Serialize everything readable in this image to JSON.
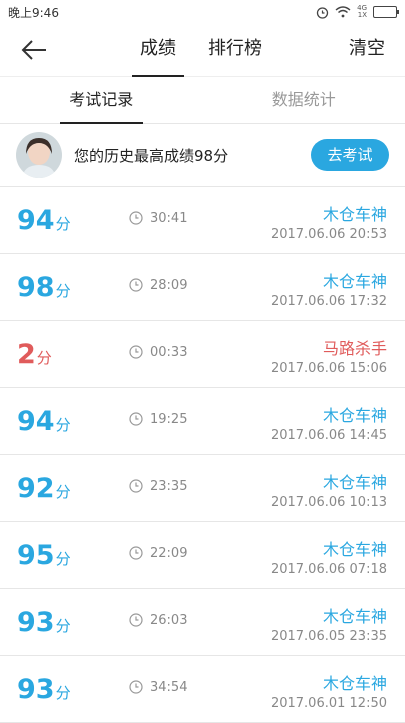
{
  "status": {
    "time": "晚上9:46",
    "signal_top": "4G",
    "signal_bottom": "1X"
  },
  "header": {
    "tabs": [
      {
        "label": "成绩",
        "active": true
      },
      {
        "label": "排行榜",
        "active": false
      }
    ],
    "clear_label": "清空"
  },
  "subtabs": [
    {
      "label": "考试记录",
      "active": true
    },
    {
      "label": "数据统计",
      "active": false
    }
  ],
  "best": {
    "text": "您的历史最高成绩98分",
    "button": "去考试"
  },
  "records": [
    {
      "score": "94",
      "unit": "分",
      "duration": "30:41",
      "title": "木仓车神",
      "date": "2017.06.06  20:53",
      "fail": false
    },
    {
      "score": "98",
      "unit": "分",
      "duration": "28:09",
      "title": "木仓车神",
      "date": "2017.06.06  17:32",
      "fail": false
    },
    {
      "score": "2",
      "unit": "分",
      "duration": "00:33",
      "title": "马路杀手",
      "date": "2017.06.06  15:06",
      "fail": true
    },
    {
      "score": "94",
      "unit": "分",
      "duration": "19:25",
      "title": "木仓车神",
      "date": "2017.06.06  14:45",
      "fail": false
    },
    {
      "score": "92",
      "unit": "分",
      "duration": "23:35",
      "title": "木仓车神",
      "date": "2017.06.06  10:13",
      "fail": false
    },
    {
      "score": "95",
      "unit": "分",
      "duration": "22:09",
      "title": "木仓车神",
      "date": "2017.06.06  07:18",
      "fail": false
    },
    {
      "score": "93",
      "unit": "分",
      "duration": "26:03",
      "title": "木仓车神",
      "date": "2017.06.05  23:35",
      "fail": false
    },
    {
      "score": "93",
      "unit": "分",
      "duration": "34:54",
      "title": "木仓车神",
      "date": "2017.06.01  12:50",
      "fail": false
    }
  ],
  "colors": {
    "accent": "#2aa7e0",
    "fail": "#e05b5b"
  }
}
